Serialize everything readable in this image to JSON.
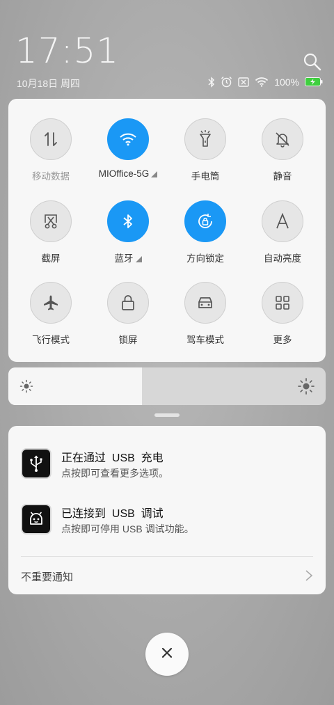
{
  "status": {
    "time": "17:51",
    "date": "10月18日 周四",
    "battery": "100%"
  },
  "quick_settings": [
    {
      "id": "mobile-data",
      "label": "移动数据",
      "active": false,
      "icon": "updown-arrows-icon"
    },
    {
      "id": "wifi",
      "label": "MIOffice-5G",
      "active": true,
      "icon": "wifi-icon"
    },
    {
      "id": "flashlight",
      "label": "手电筒",
      "active": false,
      "icon": "flashlight-icon"
    },
    {
      "id": "mute",
      "label": "静音",
      "active": false,
      "icon": "bell-off-icon"
    },
    {
      "id": "screenshot",
      "label": "截屏",
      "active": false,
      "icon": "scissors-icon"
    },
    {
      "id": "bluetooth",
      "label": "蓝牙",
      "active": true,
      "icon": "bluetooth-icon"
    },
    {
      "id": "rotation-lock",
      "label": "方向锁定",
      "active": true,
      "icon": "rotation-lock-icon"
    },
    {
      "id": "auto-brightness",
      "label": "自动亮度",
      "active": false,
      "icon": "letter-a-icon"
    },
    {
      "id": "airplane",
      "label": "飞行模式",
      "active": false,
      "icon": "airplane-icon"
    },
    {
      "id": "lock-screen",
      "label": "锁屏",
      "active": false,
      "icon": "lock-icon"
    },
    {
      "id": "driving-mode",
      "label": "驾车模式",
      "active": false,
      "icon": "car-icon"
    },
    {
      "id": "more",
      "label": "更多",
      "active": false,
      "icon": "grid-icon"
    }
  ],
  "brightness": {
    "level": 0.42
  },
  "notifications": [
    {
      "title": "正在通过  USB  充电",
      "subtitle": "点按即可查看更多选项。",
      "icon": "usb-icon"
    },
    {
      "title": "已连接到  USB  调试",
      "subtitle": "点按即可停用 USB 调试功能。",
      "icon": "android-icon"
    }
  ],
  "unimportant_label": "不重要通知",
  "colors": {
    "accent": "#1a98f5",
    "battery": "#3fcf3f"
  }
}
